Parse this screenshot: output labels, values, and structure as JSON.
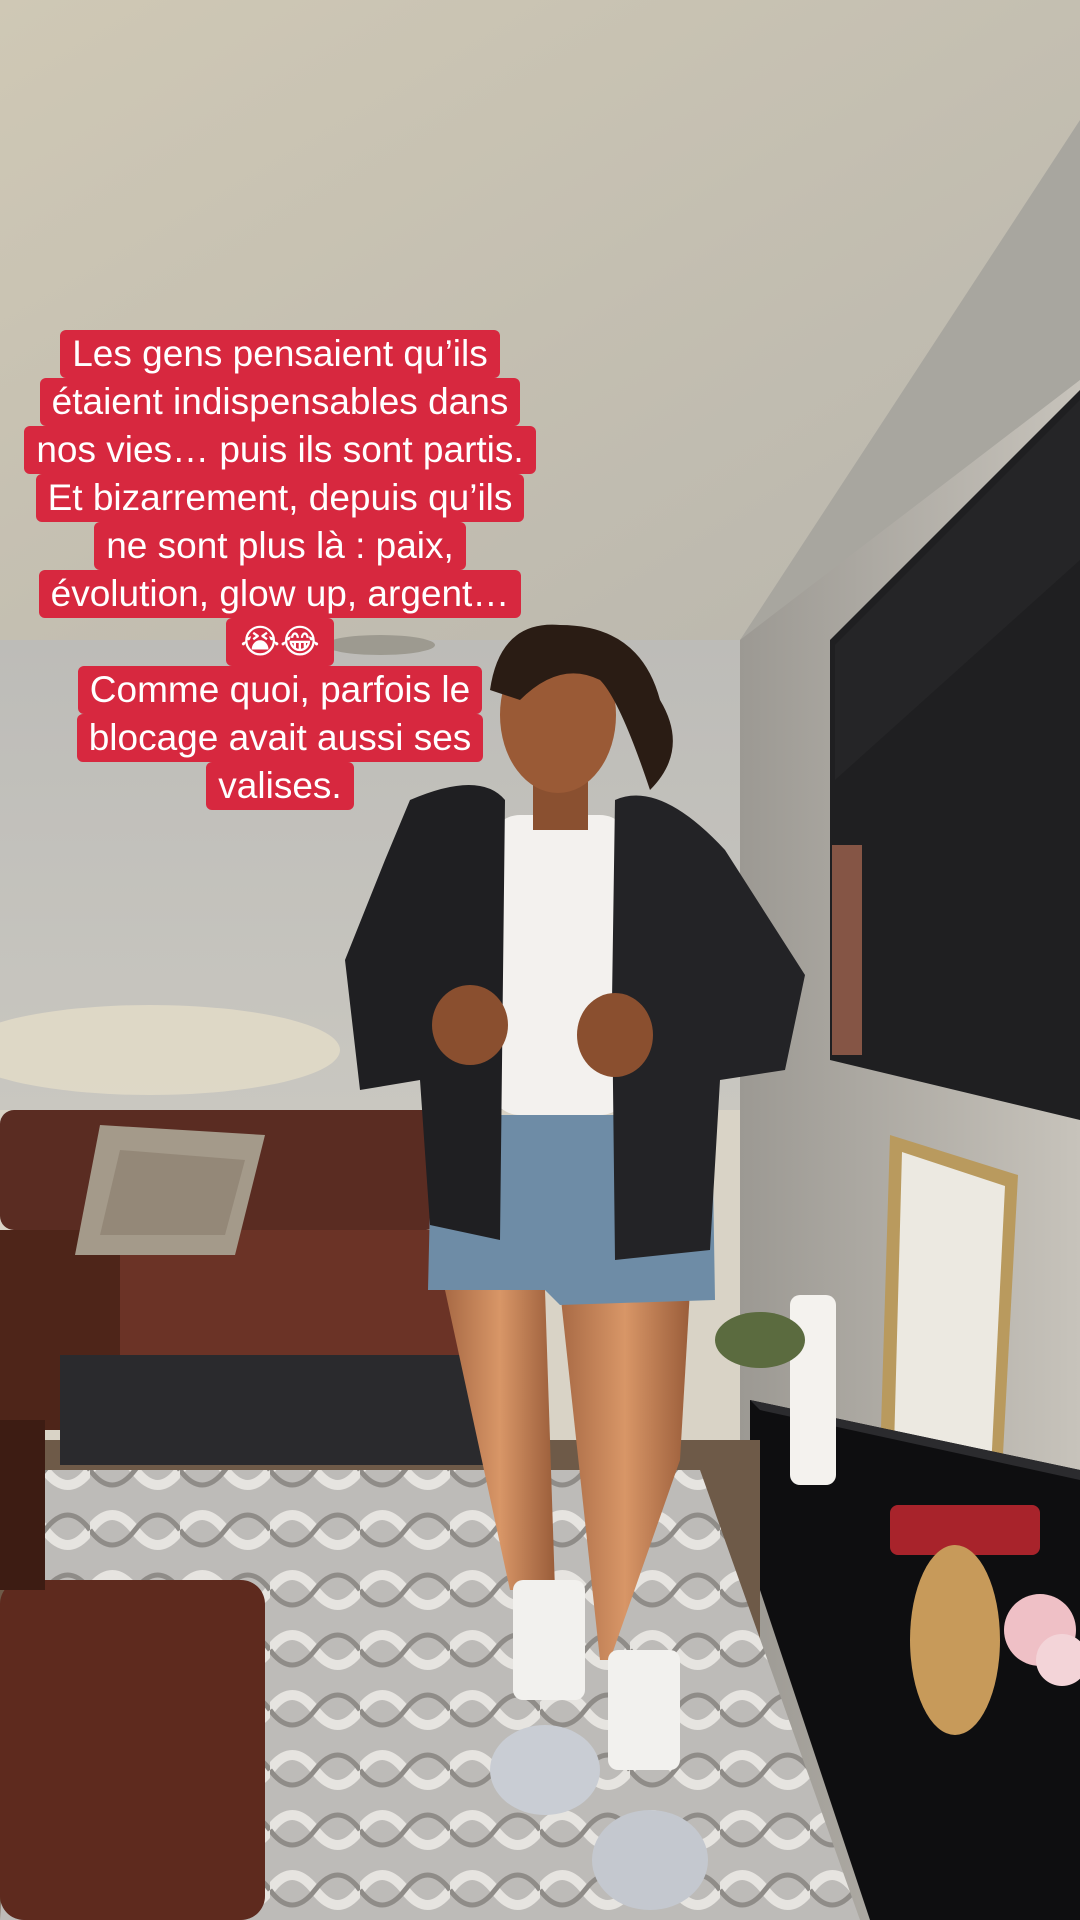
{
  "caption": {
    "lines": [
      "Les gens pensaient qu’ils",
      "étaient indispensables dans",
      "nos vies… puis ils sont partis.",
      "Et bizarrement, depuis qu’ils",
      "ne sont plus là : paix,",
      "évolution, glow up, argent…",
      "😭😂",
      "Comme quoi, parfois le",
      "blocage avait aussi ses",
      "valises."
    ]
  },
  "colors": {
    "caption_background": "#d7283f",
    "caption_text": "#ffffff"
  }
}
